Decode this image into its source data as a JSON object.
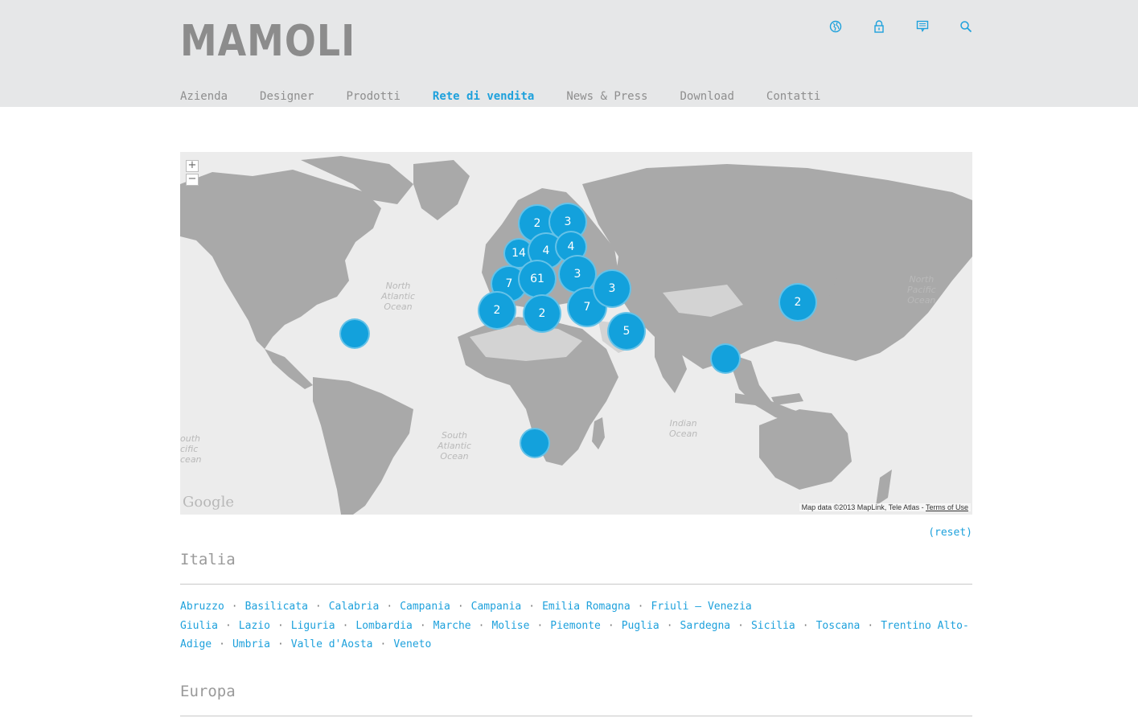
{
  "brand": {
    "logo_text": "MAMOLI"
  },
  "header_icons": [
    "globe-icon",
    "lock-icon",
    "chat-icon",
    "search-icon"
  ],
  "nav": {
    "items": [
      {
        "label": "Azienda",
        "active": false
      },
      {
        "label": "Designer",
        "active": false
      },
      {
        "label": "Prodotti",
        "active": false
      },
      {
        "label": "Rete di vendita",
        "active": true
      },
      {
        "label": "News & Press",
        "active": false
      },
      {
        "label": "Download",
        "active": false
      },
      {
        "label": "Contatti",
        "active": false
      }
    ]
  },
  "map": {
    "zoom_in": "+",
    "zoom_out": "−",
    "ocean_labels": {
      "north_atlantic": "North\nAtlantic\nOcean",
      "south_atlantic": "South\nAtlantic\nOcean",
      "north_pacific": "North\nPacific\nOcean",
      "south_pacific": "outh\ncific\ncean",
      "indian": "Indian\nOcean"
    },
    "clusters": [
      {
        "id": "caribbean",
        "count": ""
      },
      {
        "id": "scandinavia",
        "count": "2"
      },
      {
        "id": "finland",
        "count": "3"
      },
      {
        "id": "uk",
        "count": "14"
      },
      {
        "id": "germany",
        "count": "4"
      },
      {
        "id": "poland",
        "count": "4"
      },
      {
        "id": "ukraine",
        "count": "3"
      },
      {
        "id": "france",
        "count": "7"
      },
      {
        "id": "italy",
        "count": "61"
      },
      {
        "id": "spain",
        "count": "2"
      },
      {
        "id": "north-africa",
        "count": "2"
      },
      {
        "id": "turkey",
        "count": "7"
      },
      {
        "id": "caucasus",
        "count": "3"
      },
      {
        "id": "middle-east",
        "count": "5"
      },
      {
        "id": "south-africa",
        "count": ""
      },
      {
        "id": "southeast-asia",
        "count": ""
      },
      {
        "id": "japan",
        "count": "2"
      }
    ],
    "google_logo": "Google",
    "attribution": "Map data ©2013 MapLink, Tele Atlas - ",
    "terms_link": "Terms of Use"
  },
  "reset_label": "(reset)",
  "sections": {
    "italia": {
      "title": "Italia"
    },
    "europa": {
      "title": "Europa"
    }
  },
  "regions": [
    "Abruzzo",
    "Basilicata",
    "Calabria",
    "Campania",
    "Campania",
    "Emilia Romagna",
    "Friuli – Venezia Giulia",
    "Lazio",
    "Liguria",
    "Lombardia",
    "Marche",
    "Molise",
    "Piemonte",
    "Puglia",
    "Sardegna",
    "Sicilia",
    "Toscana",
    "Trentino Alto-Adige",
    "Umbria",
    "Valle d'Aosta",
    "Veneto"
  ],
  "region_separator": "·",
  "colors": {
    "accent": "#1ea1dc",
    "cluster": "#13a1dc",
    "header_bg": "#e6e7e8",
    "land": "#a8a8a8",
    "water": "#ececec"
  }
}
